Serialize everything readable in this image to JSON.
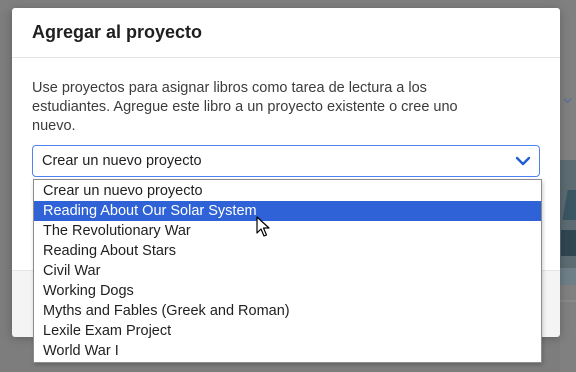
{
  "dialog": {
    "title": "Agregar al proyecto",
    "description": "Use proyectos para asignar libros como tarea de lectura a los estudiantes. Agregue este libro a un proyecto existente o cree uno nuevo.",
    "select": {
      "value": "Crear un nuevo proyecto",
      "options": [
        "Crear un nuevo proyecto",
        "Reading About Our Solar System",
        "The Revolutionary War",
        "Reading About Stars",
        "Civil War",
        "Working Dogs",
        "Myths and Fables (Greek and Roman)",
        "Lexile Exam Project",
        "World War I"
      ],
      "highlighted_index": 1
    }
  },
  "colors": {
    "accent": "#2f62d6",
    "focus_border": "#4f83f1",
    "chevron": "#1f5fd1",
    "overlay": "#7d7d7d"
  },
  "icons": {
    "select_chevron": "chevron-down-icon",
    "pointer": "mouse-pointer-icon"
  }
}
